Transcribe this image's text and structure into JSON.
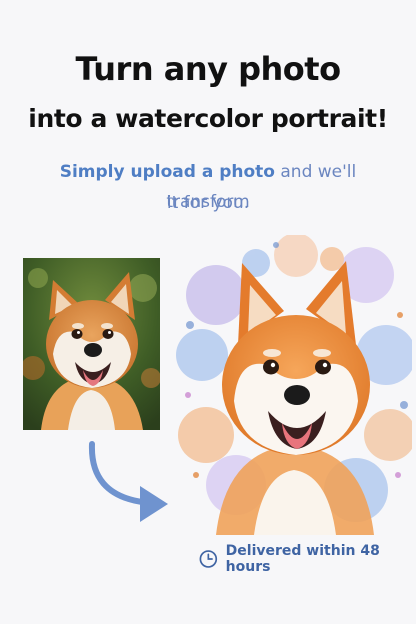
{
  "headline": {
    "line1": "Turn any photo",
    "line2": "into a watercolor portrait!"
  },
  "subheading": {
    "highlight": "Simply upload a photo",
    "rest_line1": " and we'll transform",
    "line2": "it for you."
  },
  "images": {
    "original_photo": "shiba-inu-photo",
    "watercolor_result": "shiba-inu-watercolor"
  },
  "delivery": {
    "icon": "clock-icon",
    "text": "Delivered within 48 hours"
  },
  "colors": {
    "accent": "#4f7ec4",
    "subheading": "#6b86c0",
    "arrow": "#6f93cf"
  }
}
